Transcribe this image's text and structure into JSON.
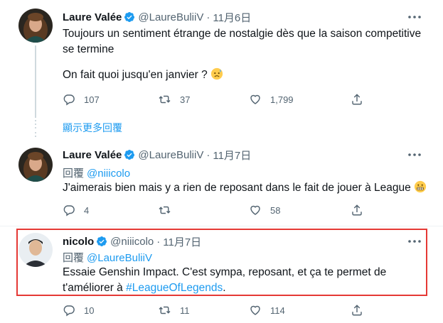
{
  "tweet1": {
    "name": "Laure Valée",
    "handle": "@LaureBuliiV",
    "dot": "·",
    "date": "11月6日",
    "line1": "Toujours un sentiment étrange de nostalgie dès que la saison competitive",
    "line2": "se termine",
    "line3": "On fait quoi jusqu'en janvier ?",
    "reply_count": "107",
    "retweet_count": "37",
    "like_count": "1,799"
  },
  "show_more_label": "顯示更多回覆",
  "tweet2": {
    "name": "Laure Valée",
    "handle": "@LaureBuliiV",
    "dot": "·",
    "date": "11月7日",
    "reply_prefix": "回覆",
    "reply_to": "@niiicolo",
    "line1": "J'aimerais bien mais y a rien de reposant dans le fait de jouer à League",
    "reply_count": "4",
    "retweet_count": "",
    "like_count": "58"
  },
  "tweet3": {
    "name": "nicolo",
    "handle": "@niiicolo",
    "dot": "·",
    "date": "11月7日",
    "reply_prefix": "回覆",
    "reply_to": "@LaureBuliiV",
    "line1": "Essaie Genshin Impact. C'est sympa, reposant, et ça te permet de",
    "line2_prefix": "t'améliorer à ",
    "hashtag": "#LeagueOfLegends",
    "line2_suffix": ".",
    "reply_count": "10",
    "retweet_count": "11",
    "like_count": "114"
  },
  "colors": {
    "accent": "#1d9bf0",
    "secondary_text": "#536471",
    "highlight_border": "#e53935"
  }
}
